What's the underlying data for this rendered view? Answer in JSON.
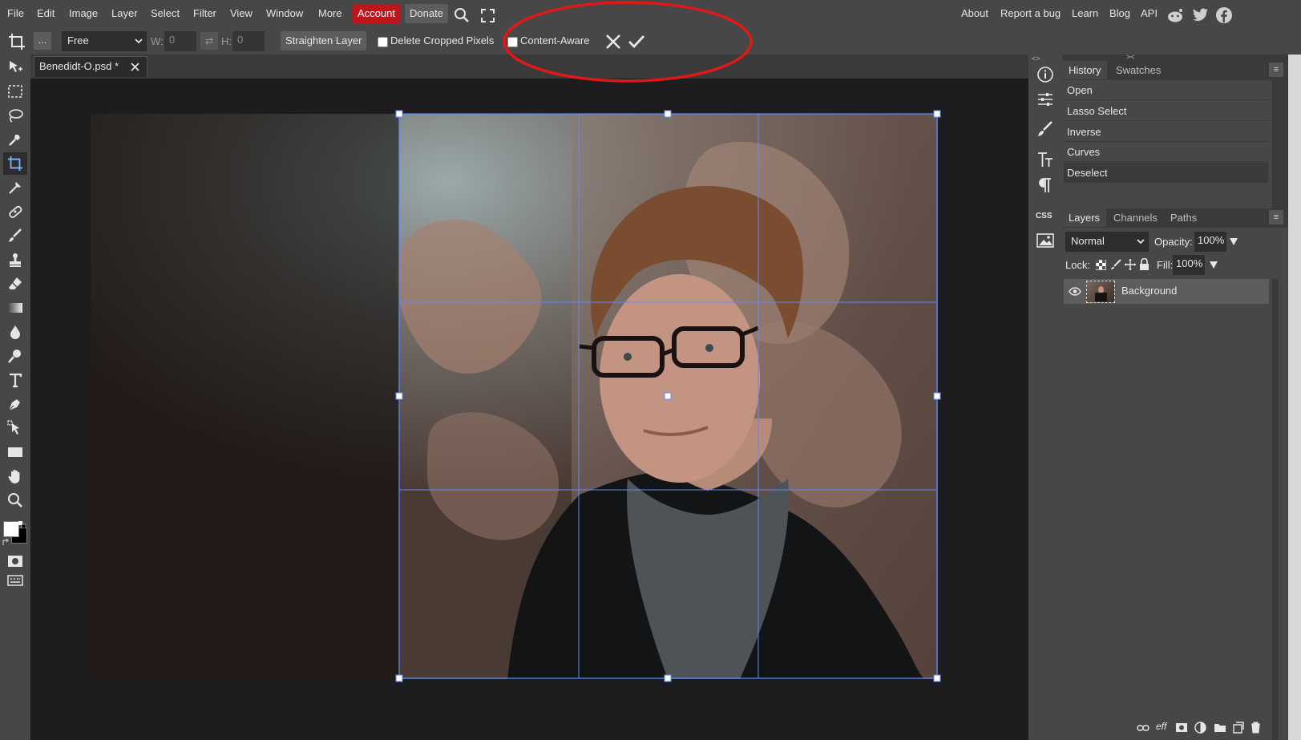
{
  "menu": {
    "items": [
      "File",
      "Edit",
      "Image",
      "Layer",
      "Select",
      "Filter",
      "View",
      "Window",
      "More"
    ],
    "account": "Account",
    "donate": "Donate"
  },
  "right_links": [
    "About",
    "Report a bug",
    "Learn",
    "Blog",
    "API"
  ],
  "options": {
    "more": "...",
    "ratio_value": "Free",
    "w_label": "W:",
    "w_value": "0",
    "h_label": "H:",
    "h_value": "0",
    "straighten": "Straighten Layer",
    "delete_cropped": "Delete Cropped Pixels",
    "content_aware": "Content-Aware"
  },
  "document": {
    "tab_title": "Benedidt-O.psd *"
  },
  "history": {
    "tabs": [
      "History",
      "Swatches"
    ],
    "items": [
      "Open",
      "Lasso Select",
      "Inverse",
      "Curves",
      "Deselect"
    ]
  },
  "layers": {
    "tabs": [
      "Layers",
      "Channels",
      "Paths"
    ],
    "blend_mode": "Normal",
    "opacity_label": "Opacity:",
    "opacity_value": "100%",
    "lock_label": "Lock:",
    "fill_label": "Fill:",
    "fill_value": "100%",
    "items": [
      "Background"
    ]
  },
  "colors": {
    "account_bg": "#c0141c",
    "annotation": "#e01818",
    "crop_grid": "#5b8cff"
  }
}
